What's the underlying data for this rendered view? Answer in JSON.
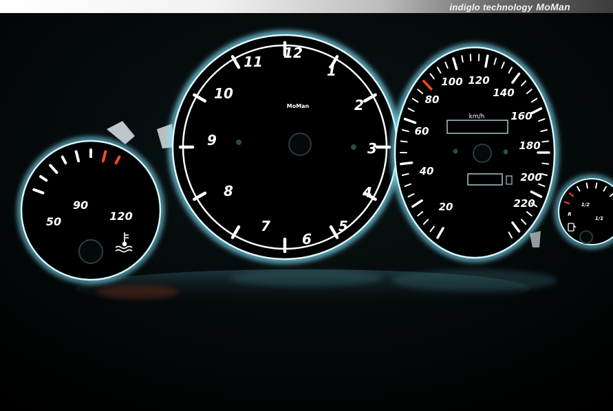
{
  "banner": {
    "text": "indiglo technology",
    "brand": "MoMan"
  },
  "colors": {
    "glow": "#7fe6ff",
    "face": "#000000",
    "warning": "#ff4a1c",
    "marking": "#ffffff"
  },
  "temperature_gauge": {
    "labels": [
      "50",
      "90",
      "120"
    ],
    "icon": "coolant-temperature-icon"
  },
  "clock": {
    "numerals": [
      "12",
      "1",
      "2",
      "3",
      "4",
      "5",
      "6",
      "7",
      "8",
      "9",
      "10",
      "11"
    ],
    "logo": "MoMan"
  },
  "speedometer": {
    "unit": "km/h",
    "labels": [
      "20",
      "40",
      "60",
      "80",
      "100",
      "120",
      "140",
      "160",
      "180",
      "200",
      "220"
    ]
  },
  "fuel_gauge": {
    "labels": [
      "R",
      "1/2",
      "1/1"
    ],
    "icon": "fuel-pump-icon"
  }
}
